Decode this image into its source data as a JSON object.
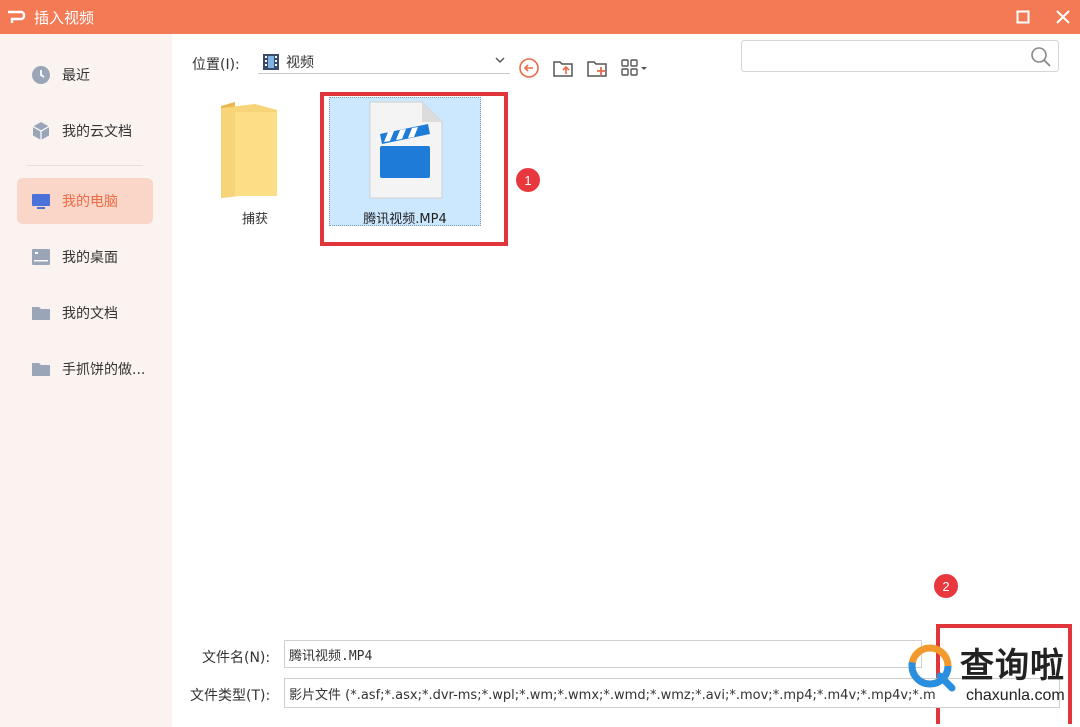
{
  "window": {
    "title": "插入视频",
    "accent_color": "#f47a56"
  },
  "sidebar": {
    "items": [
      {
        "label": "最近",
        "icon": "clock-icon"
      },
      {
        "label": "我的云文档",
        "icon": "cloud-cube-icon"
      },
      {
        "label": "我的电脑",
        "icon": "monitor-icon",
        "active": true
      },
      {
        "label": "我的桌面",
        "icon": "desktop-icon"
      },
      {
        "label": "我的文档",
        "icon": "folder-icon"
      },
      {
        "label": "手抓饼的做...",
        "icon": "folder-icon"
      }
    ],
    "active_color": "#ef6a44"
  },
  "location": {
    "label": "位置(I):",
    "value": "视频"
  },
  "search": {
    "placeholder": ""
  },
  "files": [
    {
      "name": "捕获",
      "type": "folder"
    },
    {
      "name": "腾讯视频.MP4",
      "type": "video",
      "selected": true
    }
  ],
  "annotations": {
    "badge1": "1",
    "badge2": "2",
    "highlight_color": "#e0353b"
  },
  "bottom": {
    "filename_label": "文件名(N):",
    "filename_value": "腾讯视频.MP4",
    "filetype_label": "文件类型(T):",
    "filetype_value": "影片文件 (*.asf;*.asx;*.dvr-ms;*.wpl;*.wm;*.wmx;*.wmd;*.wmz;*.avi;*.mov;*.mp4;*.m4v;*.mp4v;*.m"
  },
  "watermark": {
    "cn": "查询啦",
    "en": "chaxunla.com"
  }
}
